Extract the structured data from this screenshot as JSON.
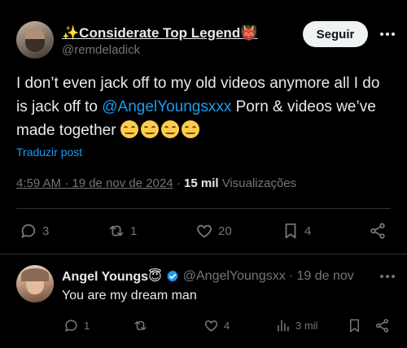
{
  "post": {
    "author_name": "✨Considerate Top Legend👹",
    "author_handle": "@remdeladick",
    "follow_label": "Seguir",
    "text_part1": "I don’t even jack off to my old videos anymore all I do is jack off to ",
    "mention": "@AngelYoungsxxx",
    "text_part2": " Porn & videos we’ve made together ",
    "translate_label": "Traduzir post",
    "timestamp": "4:59 AM · 19 de nov de 2024",
    "dot": "·",
    "views_count": "15 mil",
    "views_label": "Visualizações",
    "stats": {
      "replies": "3",
      "reposts": "1",
      "likes": "20",
      "bookmarks": "4"
    }
  },
  "reply": {
    "author_name": "Angel Youngs😇",
    "author_handle": "@AngelYoungsxx",
    "date": "· 19 de nov",
    "text": "You are my dream man",
    "stats": {
      "replies": "1",
      "likes": "4",
      "views": "3 mil"
    }
  },
  "colors": {
    "background": "#000000",
    "text": "#e7e9ea",
    "muted": "#71767b",
    "link": "#1d9bf0",
    "verified": "#1d9bf0"
  }
}
